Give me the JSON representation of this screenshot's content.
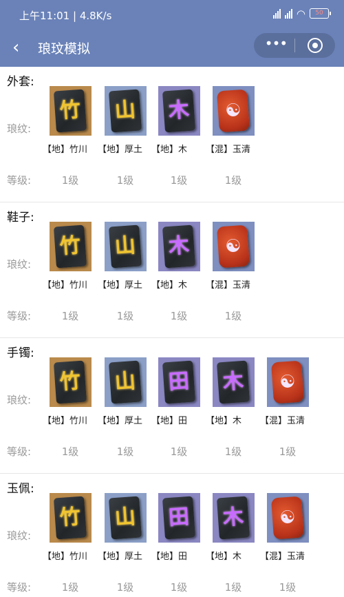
{
  "status": {
    "time_speed": "上午11:01 | 4.8K/s",
    "battery": "50"
  },
  "nav": {
    "title": "琅玟模拟"
  },
  "labels": {
    "wen": "琅纹:",
    "level": "等级:"
  },
  "sections": [
    {
      "title": "外套:",
      "items": [
        {
          "name": "【地】竹川",
          "level": "1级",
          "icon": "gold-glyph-bamboo-icon"
        },
        {
          "name": "【地】厚土",
          "level": "1级",
          "icon": "gold-glyph-earth-icon"
        },
        {
          "name": "【地】木",
          "level": "1级",
          "icon": "purple-glyph-wood-icon"
        },
        {
          "name": "【混】玉清",
          "level": "1级",
          "icon": "red-glyph-yuqing-icon"
        }
      ]
    },
    {
      "title": "鞋子:",
      "items": [
        {
          "name": "【地】竹川",
          "level": "1级",
          "icon": "gold-glyph-bamboo-icon"
        },
        {
          "name": "【地】厚土",
          "level": "1级",
          "icon": "gold-glyph-earth-icon"
        },
        {
          "name": "【地】木",
          "level": "1级",
          "icon": "purple-glyph-wood-icon"
        },
        {
          "name": "【混】玉清",
          "level": "1级",
          "icon": "red-glyph-yuqing-icon"
        }
      ]
    },
    {
      "title": "手镯:",
      "items": [
        {
          "name": "【地】竹川",
          "level": "1级",
          "icon": "gold-glyph-bamboo-icon"
        },
        {
          "name": "【地】厚土",
          "level": "1级",
          "icon": "gold-glyph-earth-icon"
        },
        {
          "name": "【地】田",
          "level": "1级",
          "icon": "purple-glyph-field-icon"
        },
        {
          "name": "【地】木",
          "level": "1级",
          "icon": "purple-glyph-wood-icon"
        },
        {
          "name": "【混】玉清",
          "level": "1级",
          "icon": "red-glyph-yuqing-icon"
        }
      ]
    },
    {
      "title": "玉佩:",
      "items": [
        {
          "name": "【地】竹川",
          "level": "1级",
          "icon": "gold-glyph-bamboo-icon"
        },
        {
          "name": "【地】厚土",
          "level": "1级",
          "icon": "gold-glyph-earth-icon"
        },
        {
          "name": "【地】田",
          "level": "1级",
          "icon": "purple-glyph-field-icon"
        },
        {
          "name": "【地】木",
          "level": "1级",
          "icon": "purple-glyph-wood-icon"
        },
        {
          "name": "【混】玉清",
          "level": "1级",
          "icon": "red-glyph-yuqing-icon"
        }
      ]
    }
  ],
  "colors": {
    "nav_bg": "#6a82b8",
    "label": "#999999"
  }
}
